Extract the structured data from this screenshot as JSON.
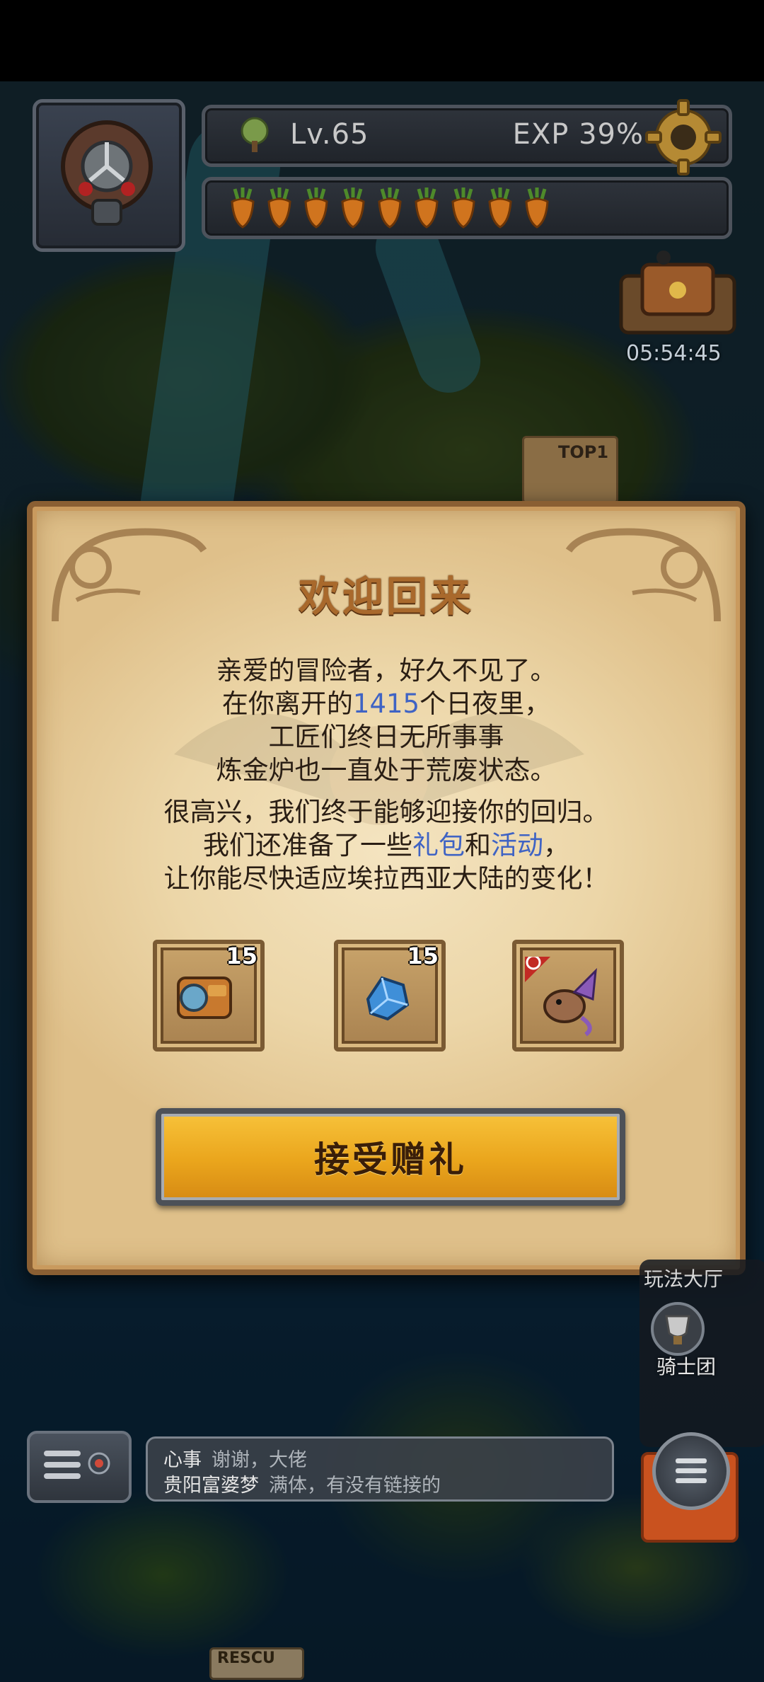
{
  "hud": {
    "level": "Lv.65",
    "exp": "EXP 39%",
    "carrot_count": 9,
    "timer": "05:54:45",
    "top1_label": "TOP1"
  },
  "dialog": {
    "title": "欢迎回来",
    "para1": {
      "line1": "亲爱的冒险者，好久不见了。",
      "line2_before": "在你离开的",
      "line2_days": "1415",
      "line2_after": "个日夜里，",
      "line3": "工匠们终日无所事事",
      "line4": "炼金炉也一直处于荒废状态。"
    },
    "para2": {
      "line1": "很高兴，我们终于能够迎接你的回归。",
      "line2_before": "我们还准备了一些",
      "line2_gift": "礼包",
      "line2_mid": "和",
      "line2_event": "活动",
      "line2_after": "，",
      "line3": "让你能尽快适应埃拉西亚大陆的变化！"
    },
    "gifts": [
      {
        "icon": "camera-device-icon",
        "count": "15"
      },
      {
        "icon": "blue-crystal-icon",
        "count": "15"
      },
      {
        "icon": "dragon-pet-icon",
        "count": ""
      }
    ],
    "accept_label": "接受赠礼"
  },
  "side": {
    "hall_label": "玩法大厅",
    "knights_label": "骑士团"
  },
  "chat": {
    "line1_name": "心事",
    "line1_msg": "谢谢，大佬",
    "line2_name": "贵阳富婆梦",
    "line2_msg": "满体，有没有链接的"
  },
  "map": {
    "rescue_label": "RESCU"
  },
  "colors": {
    "highlight_text": "#3f63c4",
    "title": "#a9692c",
    "button": "#eaa51c"
  }
}
